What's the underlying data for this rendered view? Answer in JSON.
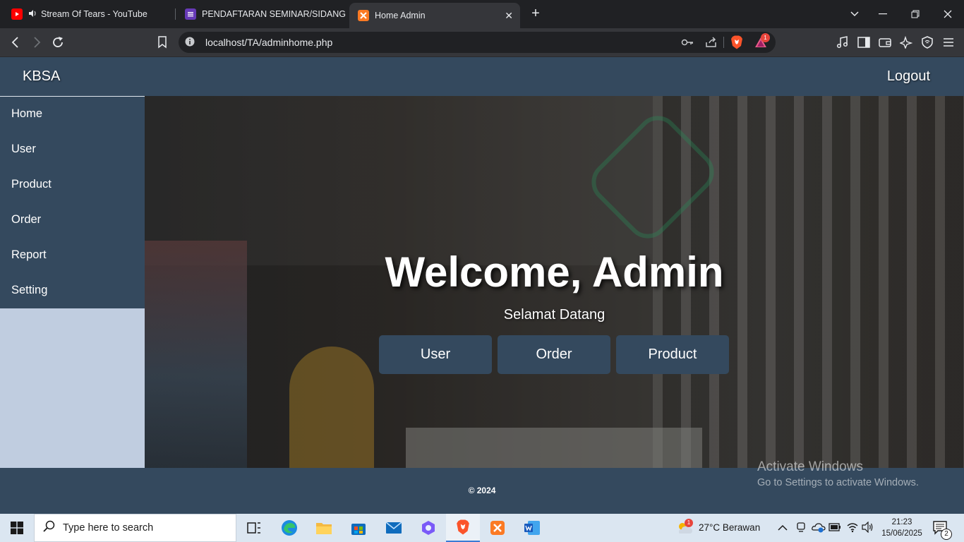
{
  "browser": {
    "tabs": [
      {
        "title": "Stream Of Tears - YouTube",
        "icon": "youtube-icon",
        "audio": true
      },
      {
        "title": "PENDAFTARAN SEMINAR/SIDANG TU",
        "icon": "forms-icon"
      },
      {
        "title": "Home Admin",
        "icon": "xampp-icon",
        "active": true
      }
    ],
    "url": "localhost/TA/adminhome.php",
    "notification_count": "1"
  },
  "page": {
    "brand": "KBSA",
    "logout_label": "Logout",
    "sidebar": [
      {
        "label": "Home"
      },
      {
        "label": "User"
      },
      {
        "label": "Product"
      },
      {
        "label": "Order"
      },
      {
        "label": "Report"
      },
      {
        "label": "Setting"
      }
    ],
    "hero": {
      "title": "Welcome, Admin",
      "subtitle": "Selamat Datang",
      "buttons": [
        {
          "label": "User"
        },
        {
          "label": "Order"
        },
        {
          "label": "Product"
        }
      ]
    },
    "footer": "© 2024",
    "watermark": {
      "line1": "Activate Windows",
      "line2": "Go to Settings to activate Windows."
    }
  },
  "taskbar": {
    "search_placeholder": "Type here to search",
    "weather": "27°C  Berawan",
    "weather_badge": "1",
    "time": "21:23",
    "date": "15/06/2025",
    "notifications": "2"
  },
  "colors": {
    "header": "#34495e",
    "sidebar_bg": "#c0cde0",
    "button": "#34495e"
  }
}
